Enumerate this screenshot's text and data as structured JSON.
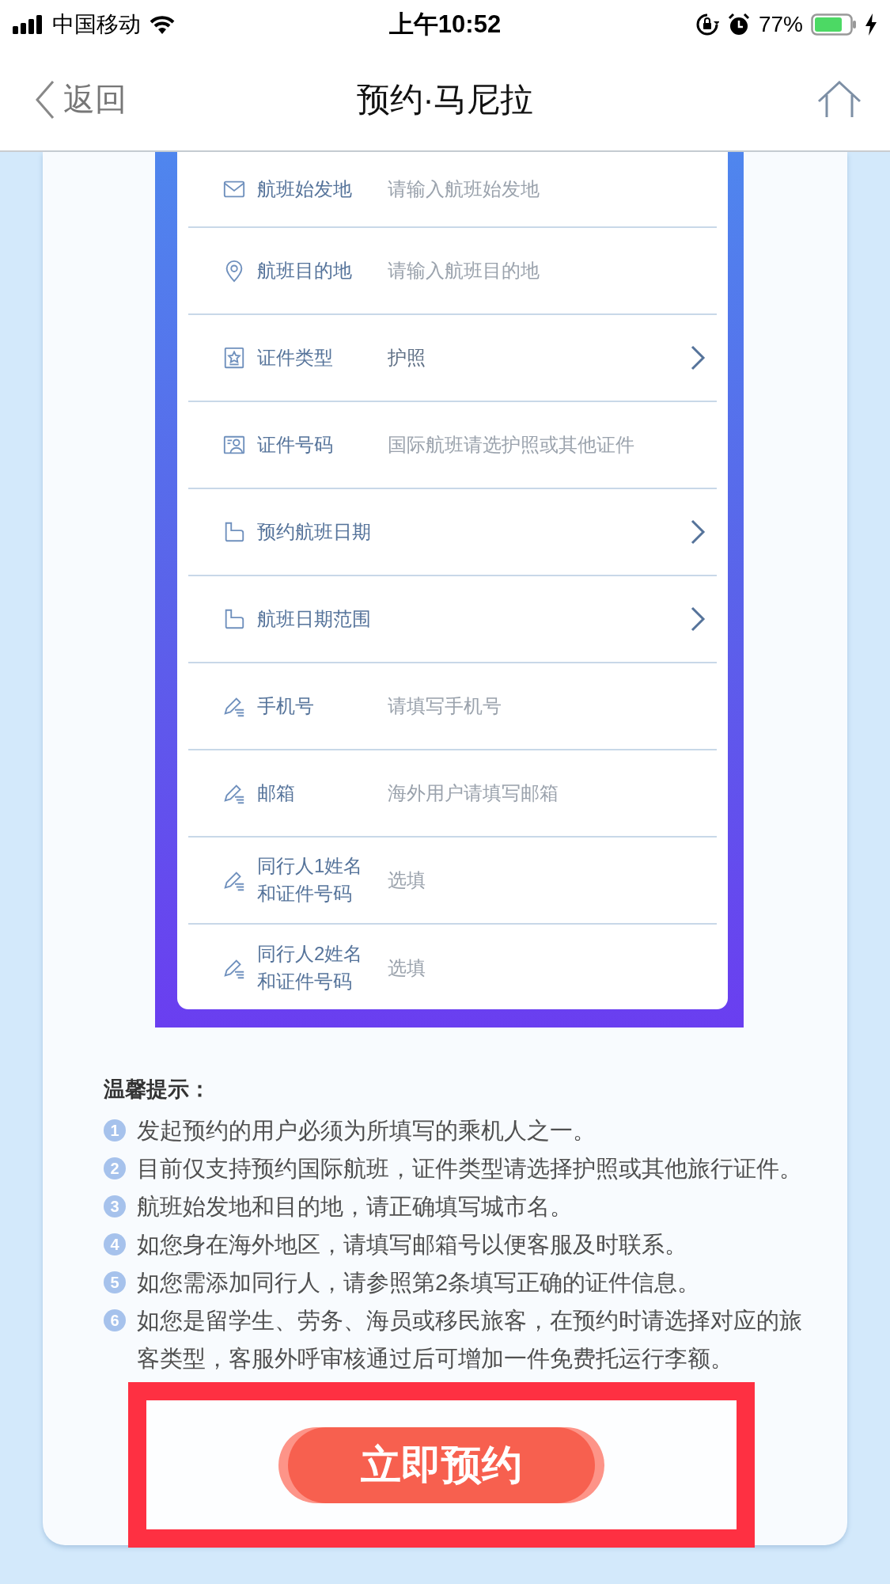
{
  "status_bar": {
    "carrier": "中国移动",
    "time": "上午10:52",
    "battery": "77%"
  },
  "nav_bar": {
    "back": "返回",
    "title": "预约·马尼拉"
  },
  "form": {
    "rows": [
      {
        "kind": "input",
        "label": "航班始发地",
        "placeholder": "请输入航班始发地"
      },
      {
        "kind": "input",
        "label": "航班目的地",
        "placeholder": "请输入航班目的地"
      },
      {
        "kind": "select",
        "label": "证件类型",
        "value": "护照"
      },
      {
        "kind": "input",
        "label": "证件号码",
        "placeholder": "国际航班请选护照或其他证件"
      },
      {
        "kind": "select",
        "label": "预约航班日期"
      },
      {
        "kind": "select",
        "label": "航班日期范围"
      },
      {
        "kind": "input",
        "label": "手机号",
        "placeholder": "请填写手机号"
      },
      {
        "kind": "input",
        "label": "邮箱",
        "placeholder": "海外用户请填写邮箱"
      },
      {
        "kind": "input",
        "label": "同行人1姓名和证件号码",
        "placeholder": "选填"
      },
      {
        "kind": "input",
        "label": "同行人2姓名和证件号码",
        "placeholder": "选填"
      }
    ]
  },
  "tips": {
    "title": "温馨提示：",
    "items": [
      {
        "number": "1",
        "text": "发起预约的用户必须为所填写的乘机人之一。"
      },
      {
        "number": "2",
        "text": "目前仅支持预约国际航班，证件类型请选择护照或其他旅行证件。"
      },
      {
        "number": "3",
        "text": "航班始发地和目的地，请正确填写城市名。"
      },
      {
        "number": "4",
        "text": "如您身在海外地区，请填写邮箱号以便客服及时联系。"
      },
      {
        "number": "5",
        "text": "如您需添加同行人，请参照第2条填写正确的证件信息。"
      },
      {
        "number": "6",
        "text": "如您是留学生、劳务、海员或移民旅客，在预约时请选择对应的旅客类型，客服外呼审核通过后可增加一件免费托运行李额。"
      }
    ]
  },
  "submit_button": "立即预约"
}
